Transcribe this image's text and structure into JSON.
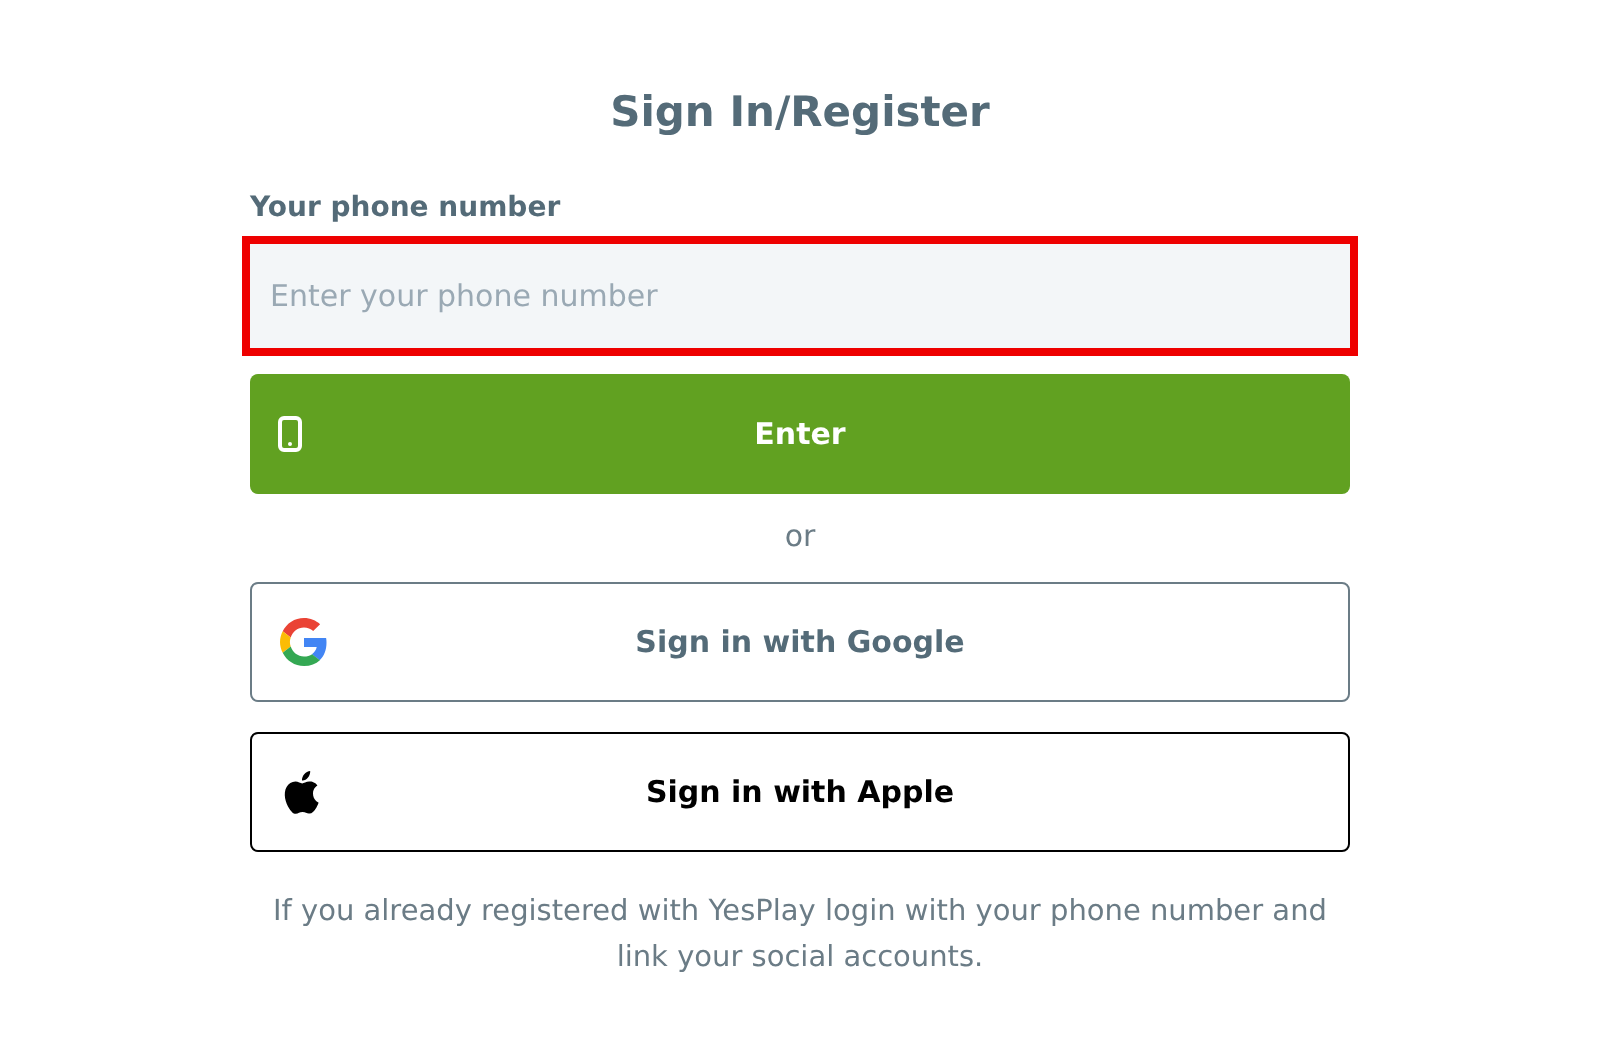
{
  "title": "Sign In/Register",
  "phone_field": {
    "label": "Your phone number",
    "placeholder": "Enter your phone number",
    "highlighted": true
  },
  "enter_button": {
    "label": "Enter"
  },
  "separator": "or",
  "social_buttons": [
    {
      "kind": "google",
      "label": "Sign in with Google"
    },
    {
      "kind": "apple",
      "label": "Sign in with Apple"
    }
  ],
  "note": "If you already registered with YesPlay login with your phone number and link your social accounts."
}
